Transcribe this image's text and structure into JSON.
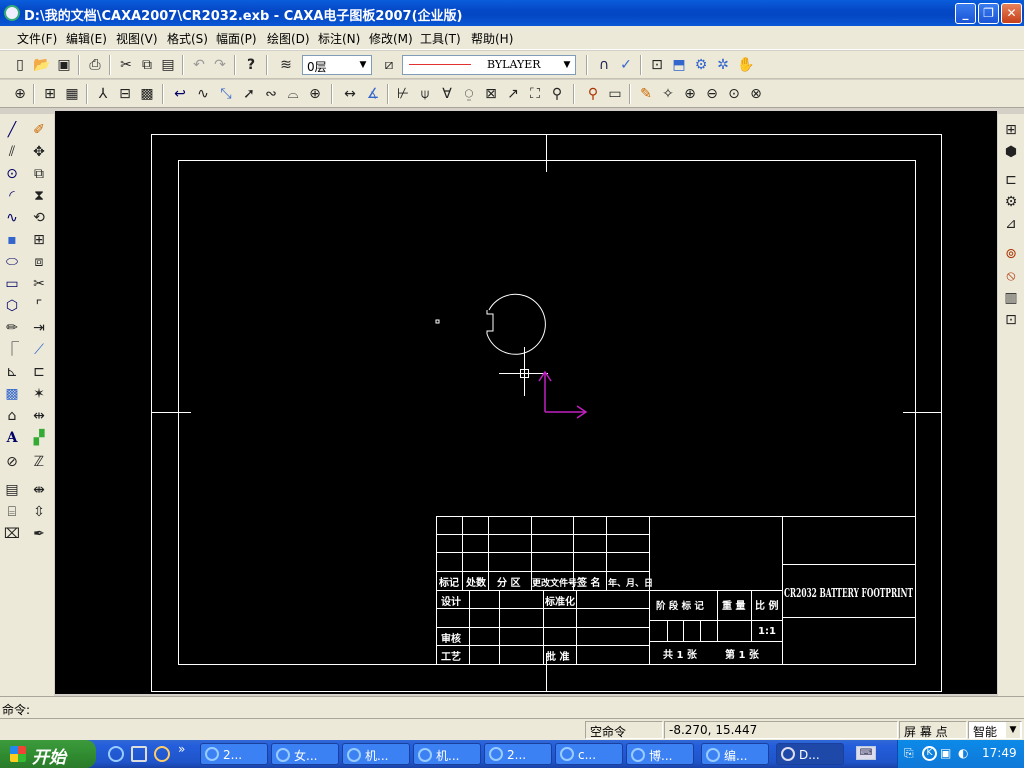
{
  "window": {
    "title": "D:\\我的文档\\CAXA2007\\CR2032.exb - CAXA电子图板2007(企业版)",
    "minimize": "_",
    "maximize": "❐",
    "close": "✕"
  },
  "menu": {
    "items": [
      {
        "label": "文件(F)"
      },
      {
        "label": "编辑(E)"
      },
      {
        "label": "视图(V)"
      },
      {
        "label": "格式(S)"
      },
      {
        "label": "幅面(P)"
      },
      {
        "label": "绘图(D)"
      },
      {
        "label": "标注(N)"
      },
      {
        "label": "修改(M)"
      },
      {
        "label": "工具(T)"
      },
      {
        "label": "帮助(H)"
      }
    ]
  },
  "toolbar1": {
    "layer": "0层",
    "linetype": "BYLAYER",
    "icons": [
      "new-icon",
      "open-icon",
      "save-icon",
      "print-icon",
      "cut-icon",
      "copy-icon",
      "paste-icon",
      "undo-icon",
      "redo-icon",
      "help-icon",
      "layer-icon",
      "linetype-icon",
      "snap-icon",
      "point-icon",
      "zoom-window-icon",
      "pan-icon",
      "zoom-icon",
      "regen-icon",
      "hand-icon"
    ]
  },
  "drawing": {
    "title_block_name": "CR2032 BATTERY FOOTPRINT",
    "scale": "1:1",
    "sheet_total": "共 1 张",
    "sheet_index": "第 1 张",
    "headers": {
      "mark": "标记",
      "count": "处数",
      "zone": "分 区",
      "doc_no": "更改文件号",
      "sign": "签 名",
      "date": "年、月、日",
      "design": "设计",
      "standard": "标准化",
      "review": "审核",
      "process": "工艺",
      "approve": "批 准",
      "stage_mark": "阶 段 标 记",
      "weight": "重 量",
      "ratio": "比 例"
    }
  },
  "command": {
    "prompt": "命令:"
  },
  "status": {
    "mode": "空命令",
    "coords": "-8.270, 15.447",
    "snap": "屏 幕 点",
    "smart": "智能"
  },
  "taskbar": {
    "start": "开始",
    "tasks": [
      {
        "label": "2..."
      },
      {
        "label": "女..."
      },
      {
        "label": "机..."
      },
      {
        "label": "机..."
      },
      {
        "label": "2..."
      },
      {
        "label": "c..."
      },
      {
        "label": "博..."
      },
      {
        "label": "编..."
      },
      {
        "label": "D..."
      }
    ],
    "clock": "17:49"
  },
  "colors": {
    "canvas_bg": "#000000",
    "frame_line": "#ffffff",
    "ucs_color": "#c020c0",
    "linetype_swatch": "#e03030"
  }
}
